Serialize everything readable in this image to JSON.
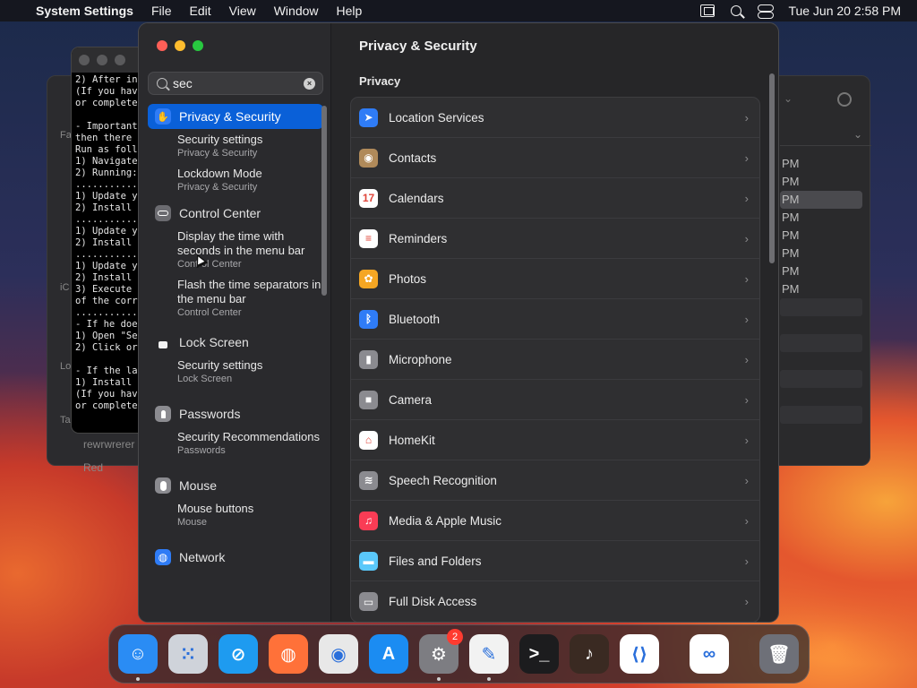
{
  "menubar": {
    "app_name": "System Settings",
    "menus": [
      "File",
      "Edit",
      "View",
      "Window",
      "Help"
    ],
    "clock": "Tue Jun 20  2:58 PM"
  },
  "terminal": {
    "text": "2) After in\n(If you hav\nor complete\n\n- Important\nthen there \nRun as foll\n1) Navigate\n2) Running:\n...........\n1) Update y\n2) Install \n...........\n1) Update y\n2) Install \n...........\n1) Update y\n2) Install \n3) Execute \nof the corr\n...........\n- If he doe\n1) Open \"Se\n2) Click or\n\n- If the la\n1) Install \n(If you hav\nor complete"
  },
  "bg_left": {
    "side_labels": [
      "Fa",
      "iC",
      "Lo",
      "Ta"
    ],
    "footer": [
      "rewrwrerer",
      "Red"
    ]
  },
  "bg_right": {
    "times": [
      "PM",
      "PM",
      "PM",
      "PM",
      "PM",
      "PM",
      "PM",
      "PM"
    ]
  },
  "search": {
    "value": "sec",
    "clear_label": "×"
  },
  "sidebar": {
    "groups": [
      {
        "label": "Privacy & Security",
        "icon": "hand-icon",
        "selected": true,
        "results": [
          {
            "title": "Security settings",
            "caption": "Privacy & Security"
          },
          {
            "title": "Lockdown Mode",
            "caption": "Privacy & Security"
          }
        ]
      },
      {
        "label": "Control Center",
        "icon": "control-center-icon",
        "results": [
          {
            "title": "Display the time with seconds in the menu bar",
            "caption": "Control Center"
          },
          {
            "title": "Flash the time separators in the menu bar",
            "caption": "Control Center"
          }
        ]
      },
      {
        "label": "Lock Screen",
        "icon": "lock-icon",
        "results": [
          {
            "title": "Security settings",
            "caption": "Lock Screen"
          }
        ]
      },
      {
        "label": "Passwords",
        "icon": "key-icon",
        "results": [
          {
            "title": "Security Recommendations",
            "caption": "Passwords"
          }
        ]
      },
      {
        "label": "Mouse",
        "icon": "mouse-icon",
        "results": [
          {
            "title": "Mouse buttons",
            "caption": "Mouse"
          }
        ]
      },
      {
        "label": "Network",
        "icon": "globe-icon",
        "results": []
      }
    ]
  },
  "content": {
    "title": "Privacy & Security",
    "section": "Privacy",
    "rows": [
      {
        "label": "Location Services",
        "icon": "location-arrow-icon",
        "color": "#2f7cf6",
        "glyph": "➤"
      },
      {
        "label": "Contacts",
        "icon": "contacts-icon",
        "color": "#b08a5a",
        "glyph": "◉"
      },
      {
        "label": "Calendars",
        "icon": "calendar-icon",
        "color": "#ffffff",
        "glyph": "17"
      },
      {
        "label": "Reminders",
        "icon": "reminders-icon",
        "color": "#ffffff",
        "glyph": "≡"
      },
      {
        "label": "Photos",
        "icon": "photos-icon",
        "color": "#f5a623",
        "glyph": "✿"
      },
      {
        "label": "Bluetooth",
        "icon": "bluetooth-icon",
        "color": "#2f7cf6",
        "glyph": "ᛒ"
      },
      {
        "label": "Microphone",
        "icon": "microphone-icon",
        "color": "#8b8b90",
        "glyph": "▮"
      },
      {
        "label": "Camera",
        "icon": "camera-icon",
        "color": "#8b8b90",
        "glyph": "■"
      },
      {
        "label": "HomeKit",
        "icon": "home-icon",
        "color": "#ffffff",
        "glyph": "⌂"
      },
      {
        "label": "Speech Recognition",
        "icon": "waveform-icon",
        "color": "#8b8b90",
        "glyph": "≋"
      },
      {
        "label": "Media & Apple Music",
        "icon": "music-note-icon",
        "color": "#fa3c55",
        "glyph": "♫"
      },
      {
        "label": "Files and Folders",
        "icon": "folder-icon",
        "color": "#5ac8fa",
        "glyph": "▬"
      },
      {
        "label": "Full Disk Access",
        "icon": "disk-icon",
        "color": "#8b8b90",
        "glyph": "▭"
      }
    ],
    "chevron": "›"
  },
  "dock": {
    "apps": [
      {
        "name": "finder-icon",
        "color": "#2a8cf4",
        "glyph": "☺",
        "running": true
      },
      {
        "name": "launchpad-icon",
        "color": "#cfd3da",
        "glyph": "⁙"
      },
      {
        "name": "safari-icon",
        "color": "#1e9bf0",
        "glyph": "⊘"
      },
      {
        "name": "firefox-icon",
        "color": "#ff7139",
        "glyph": "◍"
      },
      {
        "name": "chrome-icon",
        "color": "#e8e8e8",
        "glyph": "◉"
      },
      {
        "name": "app-store-icon",
        "color": "#1b8cf2",
        "glyph": "A"
      },
      {
        "name": "system-settings-icon",
        "color": "#7d7d82",
        "glyph": "⚙",
        "badge": "2",
        "running": true
      },
      {
        "name": "textedit-icon",
        "color": "#f2f2f2",
        "glyph": "✎",
        "running": true
      },
      {
        "name": "terminal-icon",
        "color": "#1c1c1e",
        "glyph": ">_"
      },
      {
        "name": "garageband-icon",
        "color": "#3a2a22",
        "glyph": "♪"
      },
      {
        "name": "vscode-icon",
        "color": "#ffffff",
        "glyph": "⟨⟩"
      }
    ],
    "extra": [
      {
        "name": "visual-studio-icon",
        "color": "#ffffff",
        "glyph": "∞"
      }
    ],
    "trash": {
      "name": "trash-icon",
      "color": "#6e7078",
      "glyph": "🗑"
    }
  }
}
